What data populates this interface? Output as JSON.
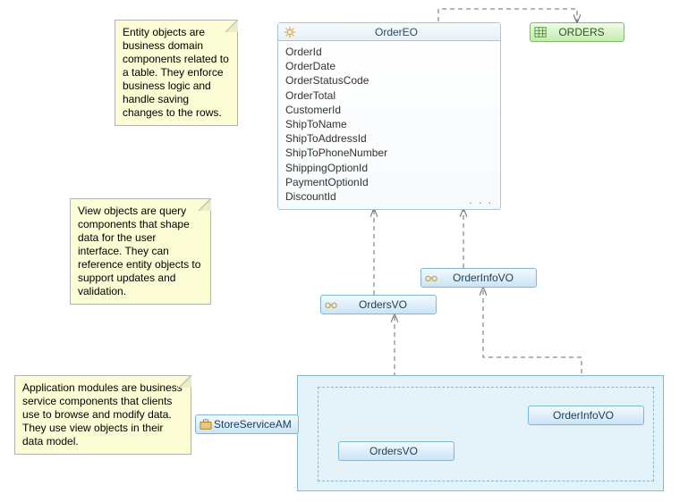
{
  "notes": {
    "entity": "Entity objects are business domain components related to a table. They enforce business logic and handle saving changes to the rows.",
    "view": "View objects are query components that shape data for the user interface. They can reference entity objects to support updates and validation.",
    "am": "Application modules are business service components that clients use to browse and modify data. They use view objects in their data model."
  },
  "entity": {
    "name": "OrderEO",
    "attributes": [
      "OrderId",
      "OrderDate",
      "OrderStatusCode",
      "OrderTotal",
      "CustomerId",
      "ShipToName",
      "ShipToAddressId",
      "ShipToPhoneNumber",
      "ShippingOptionId",
      "PaymentOptionId",
      "DiscountId"
    ]
  },
  "table": {
    "name": "ORDERS"
  },
  "views": {
    "orders": "OrdersVO",
    "orderInfo": "OrderInfoVO"
  },
  "appModule": {
    "name": "StoreServiceAM",
    "usages": {
      "orders": "OrdersVO",
      "orderInfo": "OrderInfoVO"
    }
  }
}
